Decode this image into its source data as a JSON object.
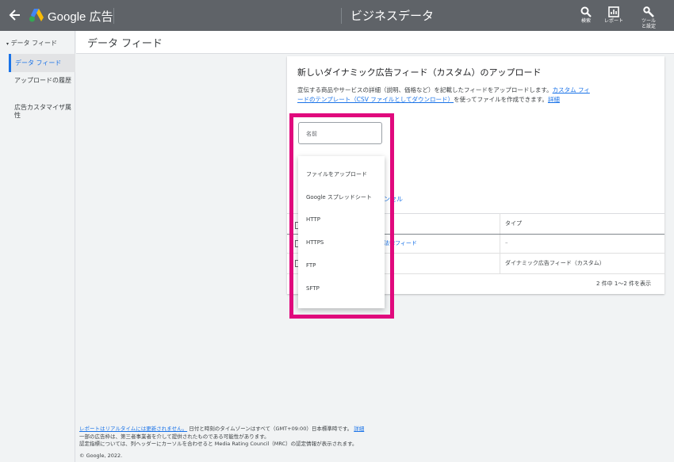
{
  "topbar": {
    "brand": "Google 広告",
    "section_title": "ビジネスデータ",
    "tools": [
      {
        "icon": "search-icon",
        "label": "検索"
      },
      {
        "icon": "chart-icon",
        "label": "レポート"
      },
      {
        "icon": "wrench-icon",
        "label": "ツールと設定"
      }
    ]
  },
  "sidebar": {
    "header": "データ フィード",
    "items": [
      {
        "label": "データ フィード",
        "active": true
      },
      {
        "label": "アップロードの履歴"
      },
      {
        "label": "広告カスタマイザ属性"
      }
    ]
  },
  "content": {
    "title": "データ フィード"
  },
  "card": {
    "title": "新しいダイナミック広告フィード（カスタム）のアップロード",
    "desc_prefix": "宣伝する商品やサービスの詳細（説明、価格など）を記載したフィードをアップロードします。",
    "desc_link": "カスタム フィードのテンプレート（CSV ファイルとしてダウンロード）",
    "desc_suffix": "を使ってファイルを作成できます。",
    "desc_details": "詳細",
    "name_placeholder": "名前",
    "upload_options": [
      "ファイルをアップロード",
      "Google スプレッドシート",
      "HTTP",
      "HTTPS",
      "FTP",
      "SFTP"
    ],
    "cancel_fragment": "ンセル"
  },
  "table": {
    "col_type": "タイプ",
    "rows": [
      {
        "name_fragment": "法律フィード",
        "type": "–"
      },
      {
        "name_fragment": "",
        "type": "ダイナミック広告フィード（カスタム）"
      }
    ],
    "pagination": "2 件中 1～2 件を表示"
  },
  "footer": {
    "line1_link": "レポートはリアルタイムには更新されません。",
    "line1_text": "日付と時刻のタイムゾーンはすべて（GMT+09:00）日本標準時です。",
    "line1_details": "詳細",
    "line2": "一部の広告枠は、第三者事業者を介して提供されたものである可能性があります。",
    "line3": "認定指標については、列ヘッダーにカーソルを合わせると Media Rating Council（MRC）の認定情報が表示されます。",
    "copyright": "© Google, 2022."
  },
  "colors": {
    "topbar": "#5f6368",
    "accent": "#1a73e8",
    "highlight": "#e0097d"
  }
}
